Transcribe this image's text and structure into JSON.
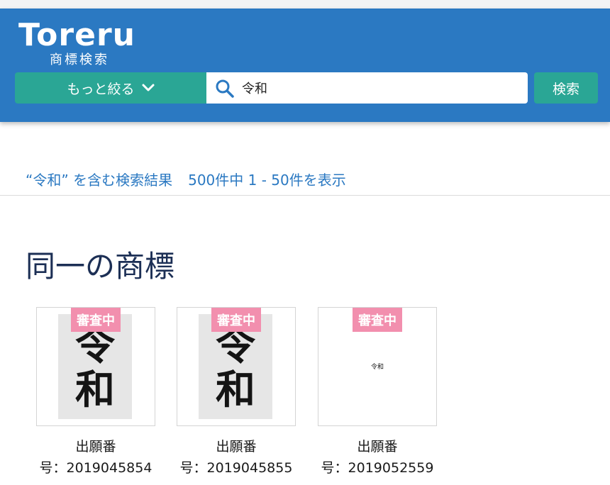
{
  "header": {
    "logo_text": "Toreru",
    "logo_sub": "商標検索",
    "narrow_label": "もっと絞る",
    "search_value": "令和",
    "search_button": "検索"
  },
  "results": {
    "query_text": "“令和” を含む検索結果",
    "count_text": "500件中 1 - 50件を表示"
  },
  "section": {
    "title": "同一の商標"
  },
  "cards": [
    {
      "badge": "審査中",
      "mark": [
        "令",
        "和"
      ],
      "label": "出願番",
      "number": "号：2019045854"
    },
    {
      "badge": "審査中",
      "mark": [
        "令",
        "和"
      ],
      "label": "出願番",
      "number": "号：2019045855"
    },
    {
      "badge": "審査中",
      "mark_text": "令和",
      "label": "出願番",
      "number": "号：2019052559"
    }
  ],
  "colors": {
    "header_bg": "#2b79c2",
    "accent_green": "#2aa695",
    "badge_pink": "#f28fae",
    "link_blue": "#2b79c2",
    "title_navy": "#1c2f55"
  }
}
